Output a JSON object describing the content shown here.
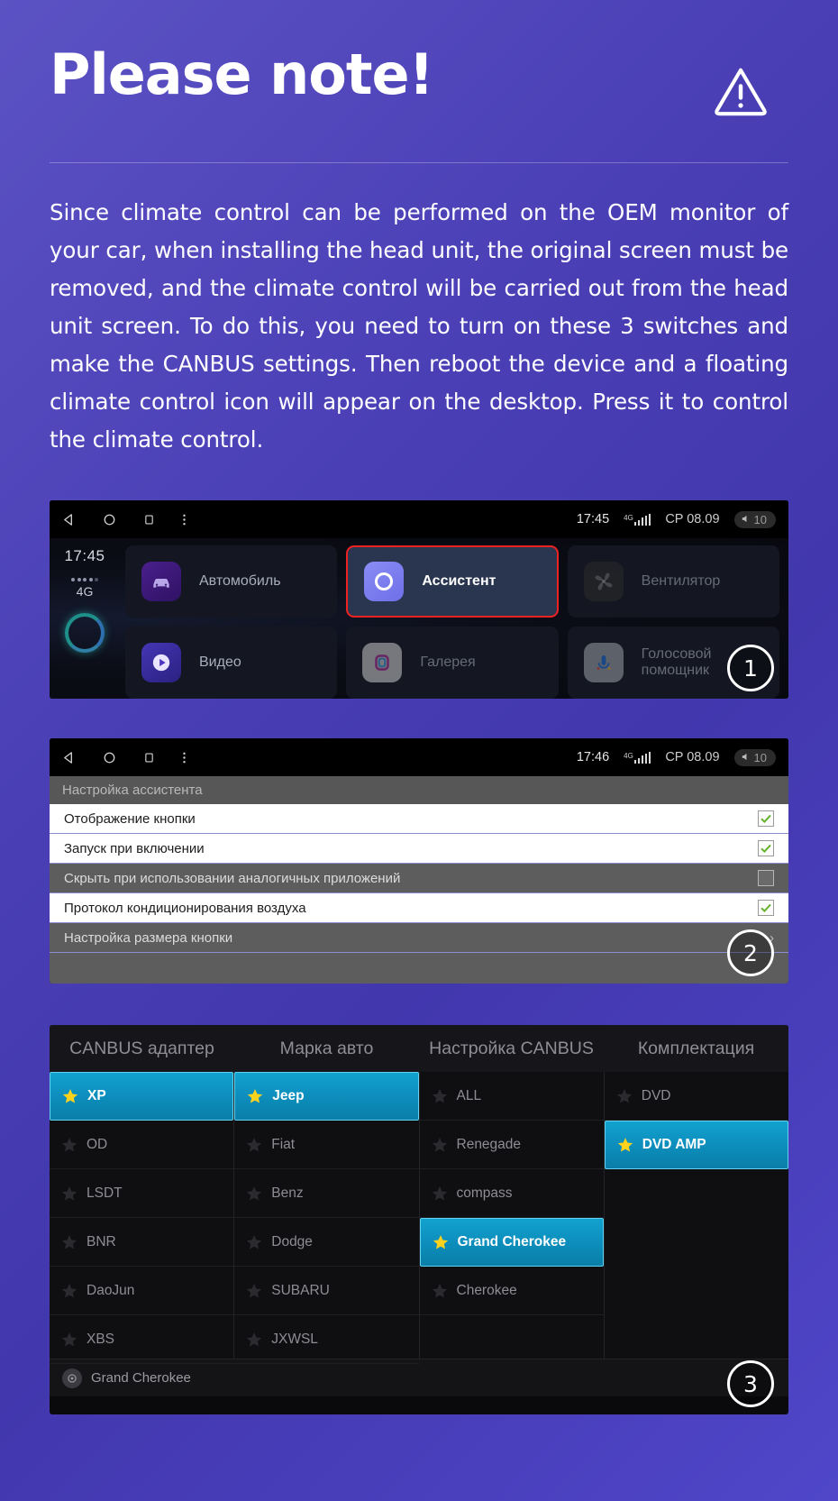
{
  "header": {
    "title": "Please note!",
    "warning_icon": "warning-triangle-icon"
  },
  "body": {
    "paragraph": "Since climate control can be performed on the OEM monitor of your car, when installing the head unit, the original screen must be removed, and the climate control will be carried out from the head unit screen. To do this, you need to turn on these 3 switches and make the CANBUS settings. Then reboot the device and a floating climate control icon will appear on the desktop. Press it to control the climate control."
  },
  "colors": {
    "background_start": "#5b52c4",
    "background_end": "#4f46c9",
    "selection_highlight": "#ef2222",
    "canbus_selected": "#0d8fbd",
    "star_selected": "#ffd21e",
    "checkbox_check": "#64b32c"
  },
  "screenshot1": {
    "badge": "1",
    "statusbar": {
      "back_icon": "back-triangle-icon",
      "home_icon": "home-circle-icon",
      "recents_icon": "recents-square-icon",
      "menu_icon": "overflow-menu-icon",
      "time": "17:45",
      "network_label": "4G",
      "signal_icon": "signal-bars-icon",
      "date": "CP 08.09",
      "volume_icon": "volume-icon",
      "volume_value": "10"
    },
    "sidebar": {
      "time": "17:45",
      "network_label": "4G",
      "ring_icon": "assistant-ring-icon"
    },
    "tiles": [
      {
        "label": "Автомобиль",
        "icon": "car-icon",
        "selected": false
      },
      {
        "label": "Ассистент",
        "icon": "assistant-icon",
        "selected": true
      },
      {
        "label": "Вентилятор",
        "icon": "fan-icon",
        "selected": false
      },
      {
        "label": "Видео",
        "icon": "video-icon",
        "selected": false
      },
      {
        "label": "Галерея",
        "icon": "gallery-icon",
        "selected": false
      },
      {
        "label": "Голосовой помощник",
        "icon": "mic-icon",
        "selected": false
      }
    ]
  },
  "screenshot2": {
    "badge": "2",
    "statusbar": {
      "time": "17:46",
      "date": "CP 08.09",
      "volume_value": "10"
    },
    "section_title": "Настройка ассистента",
    "rows": [
      {
        "label": "Отображение кнопки",
        "style": "light",
        "control": "checkbox",
        "checked": true
      },
      {
        "label": "Запуск при включении",
        "style": "light",
        "control": "checkbox",
        "checked": true
      },
      {
        "label": "Скрыть при использовании аналогичных приложений",
        "style": "dark",
        "control": "checkbox",
        "checked": false
      },
      {
        "label": "Протокол кондиционирования воздуха",
        "style": "light",
        "control": "checkbox",
        "checked": true
      },
      {
        "label": "Настройка размера кнопки",
        "style": "dark",
        "control": "chevron",
        "chevron": "›"
      }
    ]
  },
  "screenshot3": {
    "badge": "3",
    "columns": [
      {
        "header": "CANBUS адаптер",
        "items": [
          {
            "label": "XP",
            "selected": true
          },
          {
            "label": "OD",
            "selected": false
          },
          {
            "label": "LSDT",
            "selected": false
          },
          {
            "label": "BNR",
            "selected": false
          },
          {
            "label": "DaoJun",
            "selected": false
          },
          {
            "label": "XBS",
            "selected": false
          }
        ]
      },
      {
        "header": "Марка авто",
        "items": [
          {
            "label": "Jeep",
            "selected": true
          },
          {
            "label": "Fiat",
            "selected": false
          },
          {
            "label": "Benz",
            "selected": false
          },
          {
            "label": "Dodge",
            "selected": false
          },
          {
            "label": "SUBARU",
            "selected": false
          },
          {
            "label": "JXWSL",
            "selected": false
          }
        ]
      },
      {
        "header": "Настройка CANBUS",
        "items": [
          {
            "label": "ALL",
            "selected": false
          },
          {
            "label": "Renegade",
            "selected": false
          },
          {
            "label": "compass",
            "selected": false
          },
          {
            "label": "Grand Cherokee",
            "selected": true
          },
          {
            "label": "Cherokee",
            "selected": false
          }
        ]
      },
      {
        "header": "Комплектация",
        "items": [
          {
            "label": "DVD",
            "selected": false
          },
          {
            "label": "DVD AMP",
            "selected": true
          }
        ]
      }
    ],
    "footer": {
      "icon": "car-settings-icon",
      "label": "Grand Cherokee"
    }
  }
}
